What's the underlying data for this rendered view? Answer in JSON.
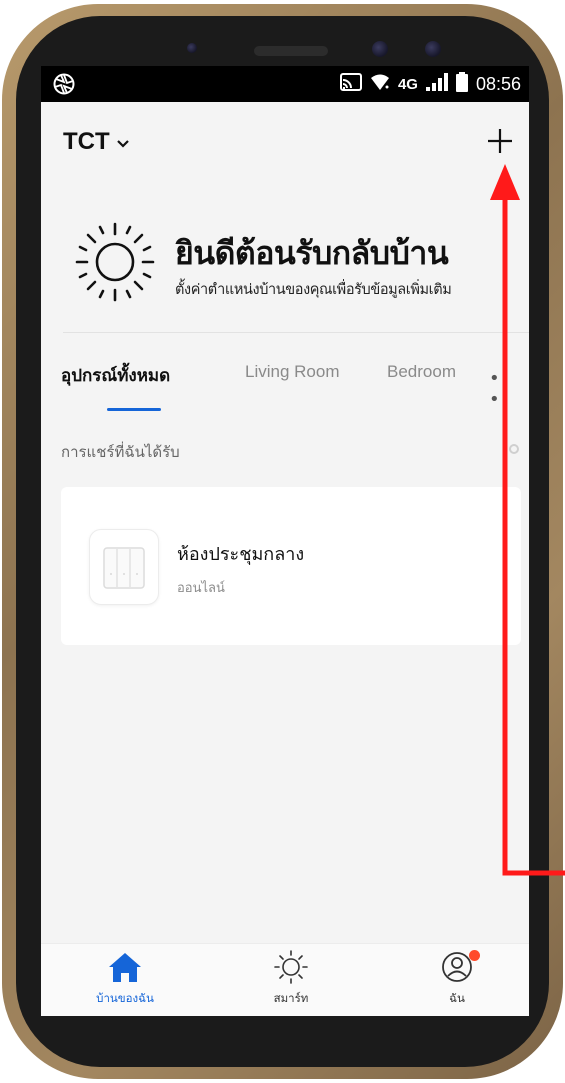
{
  "status_bar": {
    "network": "4G",
    "time": "08:56"
  },
  "header": {
    "home_name": "TCT"
  },
  "welcome": {
    "title": "ยินดีต้อนรับกลับบ้าน",
    "subtitle": "ตั้งค่าตำแหน่งบ้านของคุณเพื่อรับข้อมูลเพิ่มเติม"
  },
  "tabs": [
    {
      "label": "อุปกรณ์ทั้งหมด",
      "active": true
    },
    {
      "label": "Living Room",
      "active": false
    },
    {
      "label": "Bedroom",
      "active": false
    }
  ],
  "more_tabs": "• •",
  "shared": {
    "label": "การแชร์ที่ฉันได้รับ"
  },
  "device": {
    "name": "ห้องประชุมกลาง",
    "status": "ออนไลน์"
  },
  "bottom_nav": [
    {
      "label": "บ้านของฉัน",
      "icon": "home-icon",
      "active": true
    },
    {
      "label": "สมาร์ท",
      "icon": "sun-icon",
      "active": false
    },
    {
      "label": "ฉัน",
      "icon": "profile-icon",
      "active": false
    }
  ],
  "colors": {
    "accent": "#1565d8",
    "annotation": "#ff1a1a",
    "notification_dot": "#ff4a2b"
  }
}
